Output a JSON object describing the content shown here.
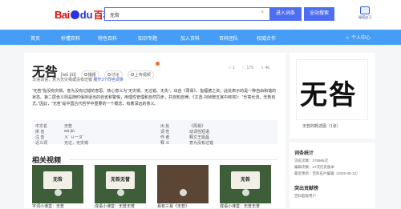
{
  "header": {
    "logo_bai": "Bai",
    "logo_du": "du",
    "logo_baike": "百科",
    "search_value": "无咎",
    "clear_icon": "×",
    "enter_label": "进入词条",
    "search_label": "全站搜索",
    "promo_text": "秘塔自习"
  },
  "nav": {
    "items": [
      "首页",
      "秒懂百科",
      "特色百科",
      "知识专题",
      "加入百科",
      "百科团队",
      "权威合作"
    ],
    "user": "个人中心"
  },
  "entry": {
    "title": "无咎",
    "pinyin": "[wú jiù]",
    "actions": [
      "播报",
      "讨论",
      "上传视频"
    ],
    "stats": [
      "1",
      "179",
      "46"
    ],
    "subtitle_prefix": "汉语词语，意为无灾祸或没有过错",
    "subtitle_link": "展开3个同名词条",
    "paragraph": "“无咎”指没有灾祸，意为没有过错的意思。核心意义为“无灾祸、无过错、无失”，出自《周易》，指福德之资。此处表示的是一种自由和谐的状态。第二层含义则是随时保持适当的自省和警惕，用理性管理和自然同步，并自知自律。《文选·刘桢赠五官中郎将》：“乐寄长流，无咎有尤。”因此，“无咎”是中国古代哲学中重要的一个概念，有着深远的意义。",
    "basic": {
      "k1": "中文名",
      "v1": "无咎",
      "k2": "拼    音",
      "v2": "wú jiù",
      "k3": "注    音",
      "v3": "ㄨˊ ㄐㄧㄡˋ",
      "k4": "近义词",
      "v4": "无过，无灾祸",
      "k5": "出    处",
      "v5": "《周易》",
      "k6": "词    性",
      "v6": "动词性短语",
      "k7": "作    者",
      "v7": "释文王姬昌",
      "k8": "释    义",
      "v8": "意为没有过错"
    }
  },
  "videos": {
    "title": "相关视频",
    "items": [
      {
        "screen": "无咎",
        "caption": "字词小课堂：无咎"
      },
      {
        "screen": "无咎无誉",
        "caption": "成语小课堂：无咎无誉"
      },
      {
        "screen": "",
        "caption": "易有三易《无咎》"
      },
      {
        "screen": "无咎",
        "caption": "成语小课堂：无咎无誉"
      }
    ]
  },
  "sidebar": {
    "album_glyph": "无咎",
    "album_caption": "无咎的概述图（1张）",
    "stats_title": "词条统计",
    "stats_lines": [
      "浏览次数：378966次",
      "编辑次数：27次历史版本",
      "最近更新：百科名片编辑（2025-05-12）"
    ],
    "tag_title": "突出贡献榜",
    "tag_line": "百科超级用户"
  },
  "colors": {
    "accent": "#4e6ef2",
    "nav": "#459df5",
    "baidu_red": "#e10601",
    "baidu_blue": "#2932e1"
  }
}
